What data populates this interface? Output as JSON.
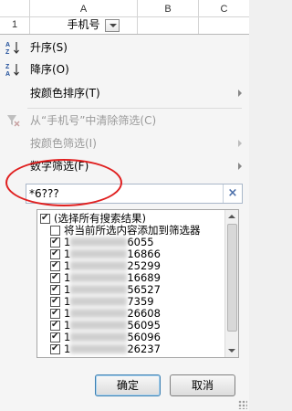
{
  "sheet": {
    "columns": [
      "A",
      "B",
      "C"
    ],
    "row_number": "1",
    "cell_a1": "手机号"
  },
  "menu": {
    "sort_asc": "升序(S)",
    "sort_desc": "降序(O)",
    "sort_by_color": "按颜色排序(T)",
    "clear_filter": "从“手机号”中清除筛选(C)",
    "filter_by_color": "按颜色筛选(I)",
    "number_filters": "数字筛选(F)"
  },
  "search": {
    "value": "*6???",
    "clear_symbol": "×"
  },
  "checklist": {
    "select_all": "(选择所有搜索结果)",
    "add_to_filter": "将当前所选内容添加到筛选器",
    "items": [
      {
        "prefix": "1",
        "suffix": "6055"
      },
      {
        "prefix": "1",
        "suffix": "16866"
      },
      {
        "prefix": "1",
        "suffix": "25299"
      },
      {
        "prefix": "1",
        "suffix": "16689"
      },
      {
        "prefix": "1",
        "suffix": "56527"
      },
      {
        "prefix": "1",
        "suffix": "7359"
      },
      {
        "prefix": "1",
        "suffix": "26608"
      },
      {
        "prefix": "1",
        "suffix": "56095"
      },
      {
        "prefix": "1",
        "suffix": "56096"
      },
      {
        "prefix": "1",
        "suffix": "26237"
      }
    ]
  },
  "buttons": {
    "ok": "确定",
    "cancel": "取消"
  },
  "colors": {
    "annotation": "#e02020",
    "disabled_text": "#9a9a9a",
    "accent": "#3c7fb1"
  }
}
